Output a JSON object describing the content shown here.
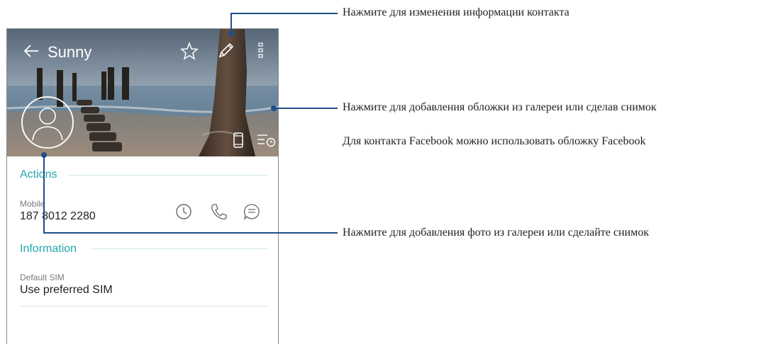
{
  "appbar": {
    "contact_name": "Sunny"
  },
  "icons": {
    "back": "back-arrow-icon",
    "favorite": "star-icon",
    "edit": "pencil-icon",
    "more": "more-vertical-icon",
    "avatar": "person-avatar-icon",
    "device": "phone-device-icon",
    "history": "call-history-icon",
    "call_log": "clock-icon",
    "call": "phone-icon",
    "message": "message-icon"
  },
  "sections": {
    "actions": {
      "title": "Actions",
      "mobile_label": "Mobile",
      "mobile_number": "187 8012 2280"
    },
    "information": {
      "title": "Information",
      "sim_label": "Default SIM",
      "sim_value": "Use preferred SIM"
    }
  },
  "callouts": [
    {
      "text": "Нажмите для изменения информации контакта"
    },
    {
      "text": "Нажмите для добавления обложки из галереи или сделав снимок"
    },
    {
      "text": "Для контакта Facebook можно использовать обложку Facebook"
    },
    {
      "text": "Нажмите для добавления фото из галереи или сделайте снимок"
    }
  ],
  "colors": {
    "accent": "#20a8ad",
    "callout": "#1f4f8a"
  }
}
